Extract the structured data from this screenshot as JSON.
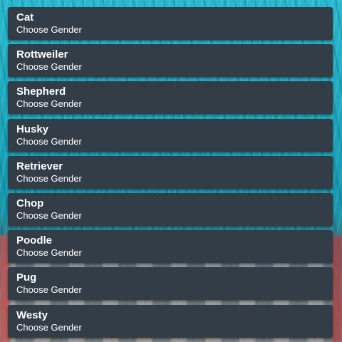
{
  "breeds": [
    {
      "name": "Cat",
      "subtitle": "Choose Gender"
    },
    {
      "name": "Rottweiler",
      "subtitle": "Choose Gender"
    },
    {
      "name": "Shepherd",
      "subtitle": "Choose Gender"
    },
    {
      "name": "Husky",
      "subtitle": "Choose Gender"
    },
    {
      "name": "Retriever",
      "subtitle": "Choose Gender"
    },
    {
      "name": "Chop",
      "subtitle": "Choose Gender"
    },
    {
      "name": "Poodle",
      "subtitle": "Choose Gender"
    },
    {
      "name": "Pug",
      "subtitle": "Choose Gender"
    },
    {
      "name": "Westy",
      "subtitle": "Choose Gender"
    }
  ],
  "colors": {
    "card_background": "#323d48",
    "text": "#ffffff",
    "background_accent": "#1aa7bd"
  }
}
